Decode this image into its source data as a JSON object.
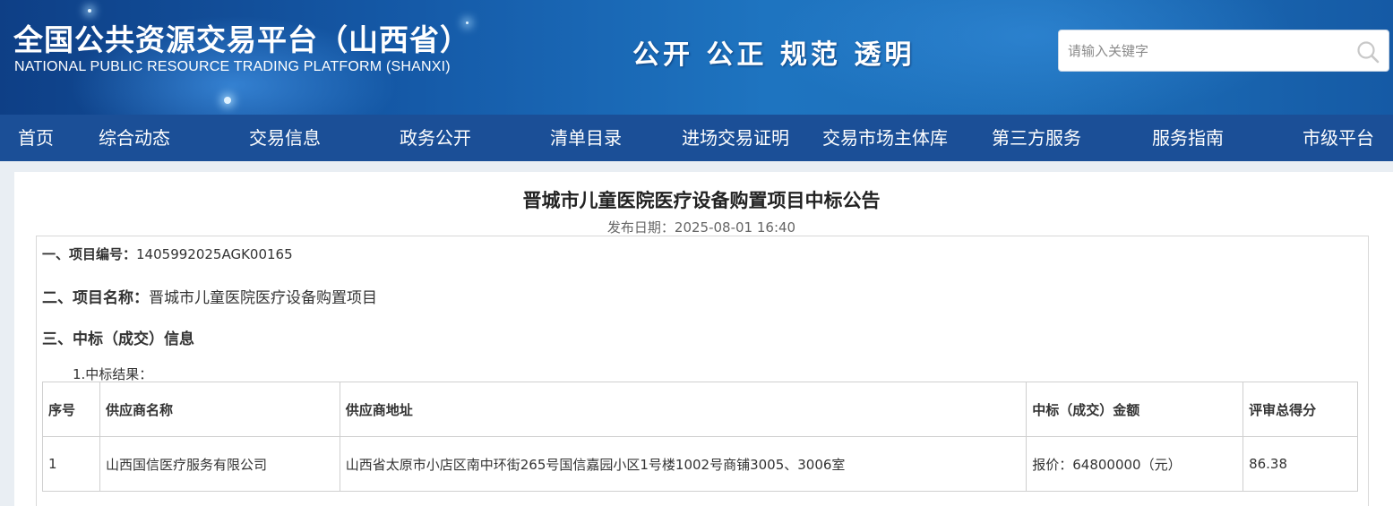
{
  "header": {
    "title_cn": "全国公共资源交易平台（山西省）",
    "title_en": "NATIONAL PUBLIC RESOURCE TRADING PLATFORM (SHANXI)",
    "slogan": "公开 公正 规范 透明",
    "search": {
      "placeholder": "请输入关键字",
      "icon": "search-icon"
    }
  },
  "nav": {
    "items": [
      {
        "label": "首页"
      },
      {
        "label": "综合动态"
      },
      {
        "label": "交易信息"
      },
      {
        "label": "政务公开"
      },
      {
        "label": "清单目录"
      },
      {
        "label": "进场交易证明"
      },
      {
        "label": "交易市场主体库"
      },
      {
        "label": "第三方服务"
      },
      {
        "label": "服务指南"
      },
      {
        "label": "市级平台"
      }
    ]
  },
  "article": {
    "title": "晋城市儿童医院医疗设备购置项目中标公告",
    "publish_label": "发布日期：",
    "publish_date": "2025-08-01 16:40",
    "sections": {
      "project_no_label": "一、项目编号：",
      "project_no": "1405992025AGK00165",
      "project_name_label": "二、项目名称：",
      "project_name": "晋城市儿童医院医疗设备购置项目",
      "award_info_label": "三、中标（成交）信息",
      "award_result_label": "1.中标结果："
    },
    "table": {
      "headers": [
        "序号",
        "供应商名称",
        "供应商地址",
        "中标（成交）金额",
        "评审总得分"
      ],
      "rows": [
        [
          "1",
          "山西国信医疗服务有限公司",
          "山西省太原市小店区南中环街265号国信嘉园小区1号楼1002号商铺3005、3006室",
          "报价：64800000（元）",
          "86.38"
        ]
      ]
    }
  }
}
